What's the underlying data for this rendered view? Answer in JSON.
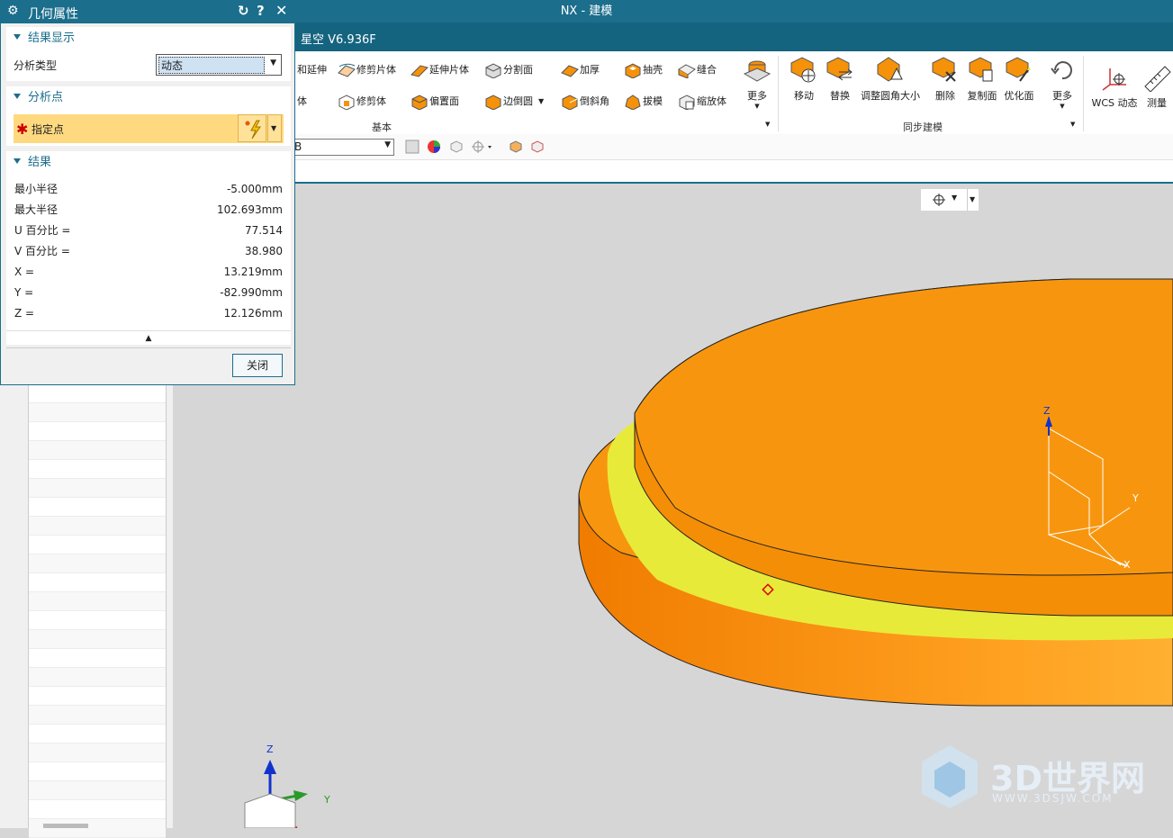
{
  "window": {
    "title": "NX - 建模",
    "product": "星空 V6.936F"
  },
  "ribbon": {
    "small_items": [
      {
        "label": "和延伸",
        "icon": "trim-extend-icon"
      },
      {
        "label": "修剪片体",
        "icon": "trim-sheet-icon"
      },
      {
        "label": "延伸片体",
        "icon": "extend-sheet-icon"
      },
      {
        "label": "分割面",
        "icon": "divide-face-icon"
      },
      {
        "label": "加厚",
        "icon": "thicken-icon"
      },
      {
        "label": "抽壳",
        "icon": "shell-icon"
      },
      {
        "label": "缝合",
        "icon": "sew-icon"
      },
      {
        "label": "体",
        "icon": "body-icon"
      },
      {
        "label": "修剪体",
        "icon": "trim-body-icon"
      },
      {
        "label": "偏置面",
        "icon": "offset-face-icon"
      },
      {
        "label": "边倒圆",
        "icon": "edge-blend-icon"
      },
      {
        "label": "倒斜角",
        "icon": "chamfer-icon"
      },
      {
        "label": "拔模",
        "icon": "draft-icon"
      },
      {
        "label": "缩放体",
        "icon": "scale-body-icon"
      }
    ],
    "more1": "更多",
    "group_basic": "基本",
    "sync_items": [
      {
        "label": "移动",
        "icon": "move-face-icon"
      },
      {
        "label": "替换",
        "icon": "replace-face-icon"
      },
      {
        "label": "调整圆角大小",
        "icon": "resize-blend-icon"
      },
      {
        "label": "删除",
        "icon": "delete-face-icon"
      },
      {
        "label": "复制面",
        "icon": "copy-face-icon"
      },
      {
        "label": "优化面",
        "icon": "optimize-face-icon"
      }
    ],
    "more2": "更多",
    "group_sync": "同步建模",
    "wcs": "WCS 动态",
    "measure": "测量"
  },
  "toolbar2": {
    "select_value": "B"
  },
  "dialog": {
    "title": "几何属性",
    "section_display": "结果显示",
    "analysis_type_label": "分析类型",
    "analysis_type_value": "动态",
    "section_point": "分析点",
    "specify_point": "指定点",
    "section_results": "结果",
    "results": [
      {
        "label": "最小半径",
        "value": "-5.000mm"
      },
      {
        "label": "最大半径",
        "value": "102.693mm"
      },
      {
        "label": "U 百分比 =",
        "value": "77.514"
      },
      {
        "label": "V 百分比 =",
        "value": "38.980"
      },
      {
        "label": "X =",
        "value": "13.219mm"
      },
      {
        "label": "Y =",
        "value": "-82.990mm"
      },
      {
        "label": "Z =",
        "value": "12.126mm"
      }
    ],
    "close_label": "关闭"
  },
  "triad": {
    "z": "Z",
    "y": "Y",
    "x": "X"
  },
  "watermark": {
    "brand": "3D世界网",
    "url": "WWW.3DSJW.COM"
  },
  "colors": {
    "accent": "#1b6e8c",
    "part_orange": "#f5920a",
    "highlight_yellow": "#e8ea3a"
  }
}
